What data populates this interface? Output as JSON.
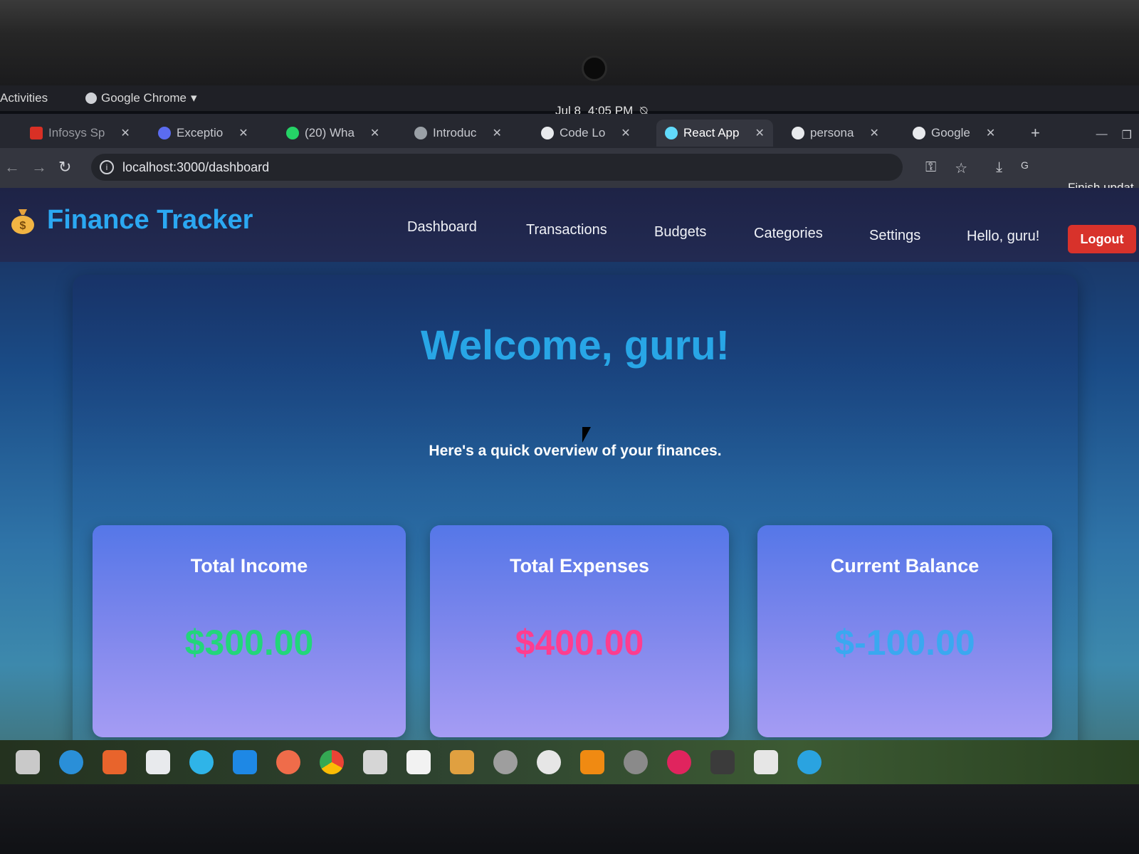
{
  "os": {
    "activities": "Activities",
    "app_menu": "Google Chrome",
    "date": "Jul 8",
    "time": "4:05 PM"
  },
  "browser": {
    "tabs": [
      {
        "label": "Infosys Sp",
        "favicon_color": "#d93025"
      },
      {
        "label": "Exceptio",
        "favicon_color": "#5b6cf0"
      },
      {
        "label": "(20) Wha",
        "favicon_color": "#25d366"
      },
      {
        "label": "Introduc",
        "favicon_color": "#9aa0a6"
      },
      {
        "label": "Code Lo",
        "favicon_color": "#e8eaed"
      },
      {
        "label": "React App",
        "favicon_color": "#61dafb"
      },
      {
        "label": "persona",
        "favicon_color": "#e8eaed"
      },
      {
        "label": "Google",
        "favicon_color": "#e8eaed"
      }
    ],
    "active_tab_index": 5,
    "url": "localhost:3000/dashboard",
    "finish_update": "Finish updat"
  },
  "app": {
    "brand": "Finance Tracker",
    "nav": [
      "Dashboard",
      "Transactions",
      "Budgets",
      "Categories",
      "Settings"
    ],
    "greeting": "Hello, guru!",
    "logout_label": "Logout",
    "welcome": "Welcome, guru!",
    "subtitle": "Here's a quick overview of your finances.",
    "cards": [
      {
        "title": "Total Income",
        "amount": "$300.00",
        "color": "#22d67a"
      },
      {
        "title": "Total Expenses",
        "amount": "$400.00",
        "color": "#ff3d8f"
      },
      {
        "title": "Current Balance",
        "amount": "$-100.00",
        "color": "#3aa8f0"
      }
    ]
  },
  "colors": {
    "brand": "#2ba8f2",
    "logout_bg": "#d8322b"
  },
  "dock": {
    "icons": [
      "files-icon",
      "thunderbird-icon",
      "software-center-icon",
      "text-editor-icon",
      "help-icon",
      "vscode-icon",
      "postman-icon",
      "chrome-icon",
      "image-viewer-icon",
      "document-icon",
      "archive-icon",
      "settings-icon",
      "disk-icon",
      "vlc-icon",
      "app-store-icon",
      "alert-icon",
      "terminal-icon",
      "notes-icon",
      "telegram-icon"
    ]
  }
}
